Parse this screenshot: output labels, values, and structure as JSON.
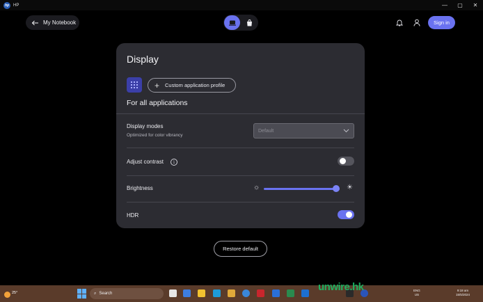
{
  "window": {
    "title": "HP",
    "logo_text": "hp",
    "controls": [
      "—",
      "▢",
      "✕"
    ]
  },
  "header": {
    "back_label": "My Notebook",
    "signin_label": "Sign in",
    "accent": "#6a72f0"
  },
  "display": {
    "title": "Display",
    "custom_profile_label": "Custom application profile",
    "section_title": "For all applications",
    "display_modes": {
      "label": "Display modes",
      "sublabel": "Optimized for color vibrancy",
      "selected": "Default"
    },
    "adjust_contrast": {
      "label": "Adjust contrast",
      "enabled": false
    },
    "brightness": {
      "label": "Brightness",
      "value_fraction": 0.95
    },
    "hdr": {
      "label": "HDR",
      "enabled": true
    },
    "restore_label": "Restore default"
  },
  "taskbar": {
    "temperature": "25°",
    "search_placeholder": "Search",
    "watermark": "unwire.hk",
    "lang_top": "ENG",
    "lang_bottom": "US",
    "time": "9:18 am",
    "date": "15/5/2024"
  }
}
